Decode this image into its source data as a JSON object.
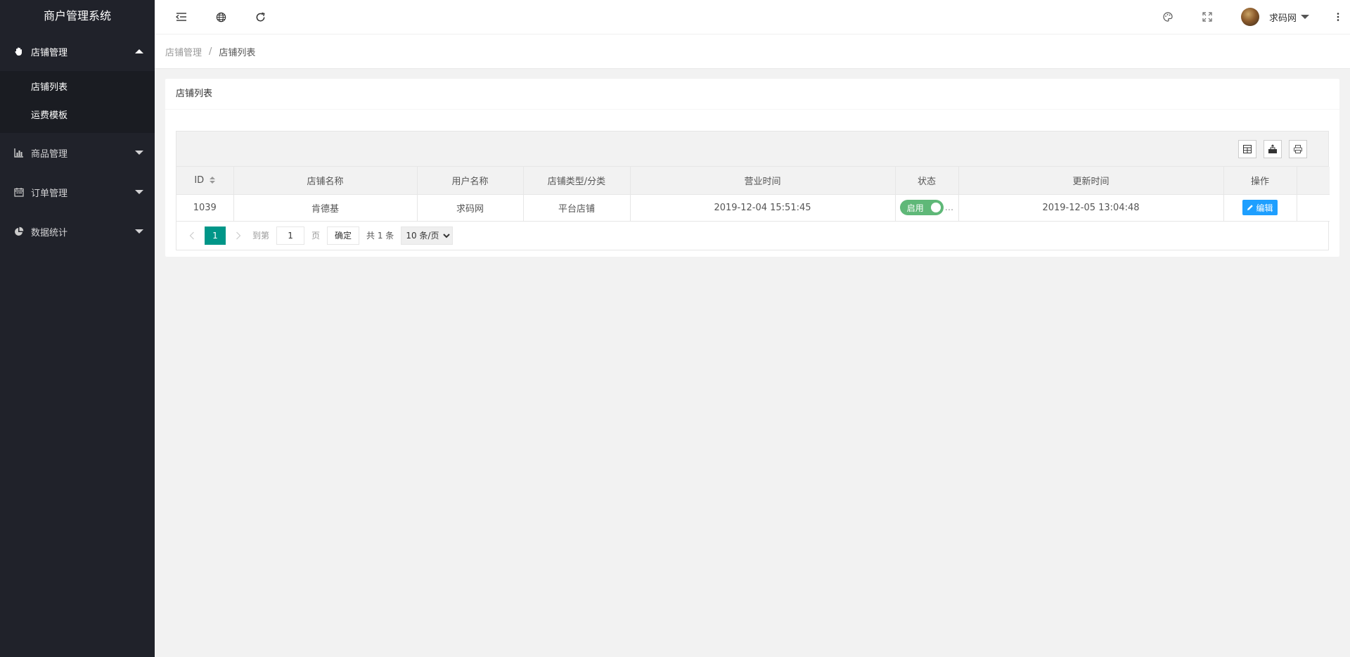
{
  "app": {
    "title": "商户管理系统"
  },
  "sidebar": {
    "groups": [
      {
        "label": "店铺管理",
        "items": [
          {
            "label": "店铺列表"
          },
          {
            "label": "运费模板"
          }
        ]
      },
      {
        "label": "商品管理"
      },
      {
        "label": "订单管理"
      },
      {
        "label": "数据统计"
      }
    ]
  },
  "header": {
    "user_name": "求码网"
  },
  "breadcrumb": {
    "parent": "店铺管理",
    "separator": "/",
    "current": "店铺列表"
  },
  "card": {
    "title": "店铺列表"
  },
  "table": {
    "columns": [
      "ID",
      "店铺名称",
      "用户名称",
      "店铺类型/分类",
      "营业时间",
      "状态",
      "更新时间",
      "操作"
    ],
    "rows": [
      {
        "id": "1039",
        "shop_name": "肯德基",
        "user_name": "求码网",
        "type": "平台店铺",
        "open_time": "2019-12-04 15:51:45",
        "status_label": "启用",
        "status_more": "...",
        "updated": "2019-12-05 13:04:48",
        "action_label": "编辑"
      }
    ]
  },
  "pagination": {
    "current_page": "1",
    "goto_label": "到第",
    "goto_value": "1",
    "page_suffix": "页",
    "confirm_label": "确定",
    "total_label": "共 1 条",
    "page_size": "10 条/页"
  },
  "colors": {
    "sidebar_bg": "#20222a",
    "switch_on": "#5fb878",
    "primary": "#1e9fff",
    "pager_active": "#009688"
  }
}
